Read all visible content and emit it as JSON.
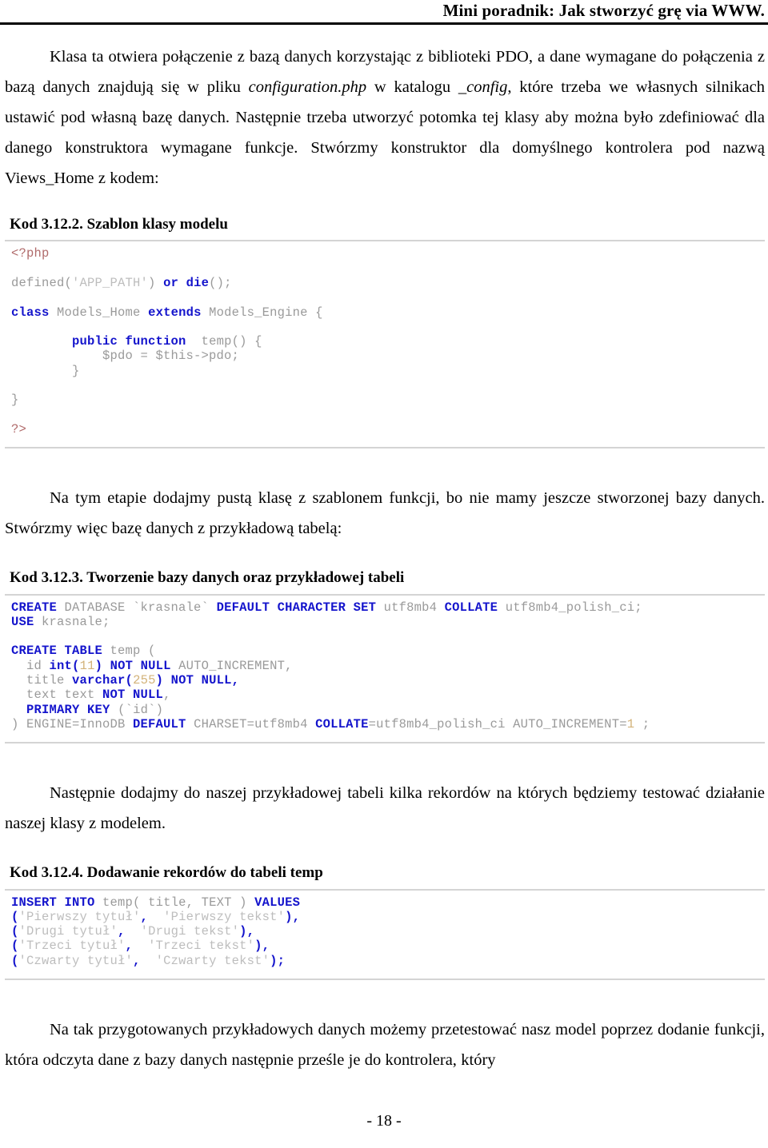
{
  "header": {
    "title": "Mini poradnik: Jak stworzyć grę via WWW."
  },
  "paragraphs": {
    "p1_a": "Klasa ta otwiera połączenie z bazą danych korzystając z biblioteki PDO, a dane wymagane do połączenia z bazą danych znajdują się w pliku ",
    "p1_em1": "configuration.php",
    "p1_b": " w katalogu ",
    "p1_em2": "_config",
    "p1_c": ", które trzeba we własnych silnikach ustawić pod własną bazę danych. Następnie trzeba utworzyć potomka tej klasy aby można było zdefiniować dla danego konstruktora wymagane funkcje. Stwórzmy konstruktor dla domyślnego kontrolera pod nazwą Views_Home z kodem:",
    "p2": "Na tym etapie dodajmy pustą klasę z szablonem funkcji, bo nie mamy jeszcze stworzonej bazy danych. Stwórzmy więc bazę danych z przykładową tabelą:",
    "p3": "Następnie dodajmy do naszej przykładowej tabeli kilka rekordów na których będziemy testować działanie naszej klasy z modelem.",
    "p4": "Na tak przygotowanych przykładowych danych możemy przetestować nasz model poprzez dodanie funkcji, która odczyta dane z bazy danych następnie prześle je do kontrolera, który"
  },
  "code_blocks": [
    {
      "title": "Kod 3.12.2. Szablon klasy modelu",
      "language": "php",
      "lines": [
        "<?php",
        "",
        "defined('APP_PATH') or die();",
        "",
        "class Models_Home extends Models_Engine {",
        "",
        "        public function  temp() {",
        "            $pdo = $this->pdo;",
        "        }",
        "",
        "}",
        "",
        "?>"
      ]
    },
    {
      "title": "Kod 3.12.3. Tworzenie bazy danych oraz przykładowej tabeli",
      "language": "sql",
      "lines": [
        "CREATE DATABASE `krasnale` DEFAULT CHARACTER SET utf8mb4 COLLATE utf8mb4_polish_ci;",
        "USE krasnale;",
        "",
        "CREATE TABLE temp (",
        "  id int(11) NOT NULL AUTO_INCREMENT,",
        "  title varchar(255) NOT NULL,",
        "  text text NOT NULL,",
        "  PRIMARY KEY (`id`)",
        ") ENGINE=InnoDB DEFAULT CHARSET=utf8mb4 COLLATE=utf8mb4_polish_ci AUTO_INCREMENT=1 ;"
      ]
    },
    {
      "title": "Kod 3.12.4. Dodawanie rekordów do tabeli temp",
      "language": "sql",
      "lines": [
        "INSERT INTO temp( title, TEXT ) VALUES",
        "('Pierwszy tytuł',  'Pierwszy tekst'),",
        "('Drugi tytuł',  'Drugi tekst'),",
        "('Trzeci tytuł',  'Trzeci tekst'),",
        "('Czwarty tytuł',  'Czwarty tekst');"
      ]
    }
  ],
  "footer": {
    "page_number": "- 18 -"
  },
  "colors": {
    "keyword": "#1414cc",
    "php_tag": "#b06a6a",
    "string": "#bdbdbd",
    "number": "#d3b37a",
    "plain": "#8c8c8c",
    "rule": "#d4d4d4",
    "header_rule": "#000000"
  }
}
